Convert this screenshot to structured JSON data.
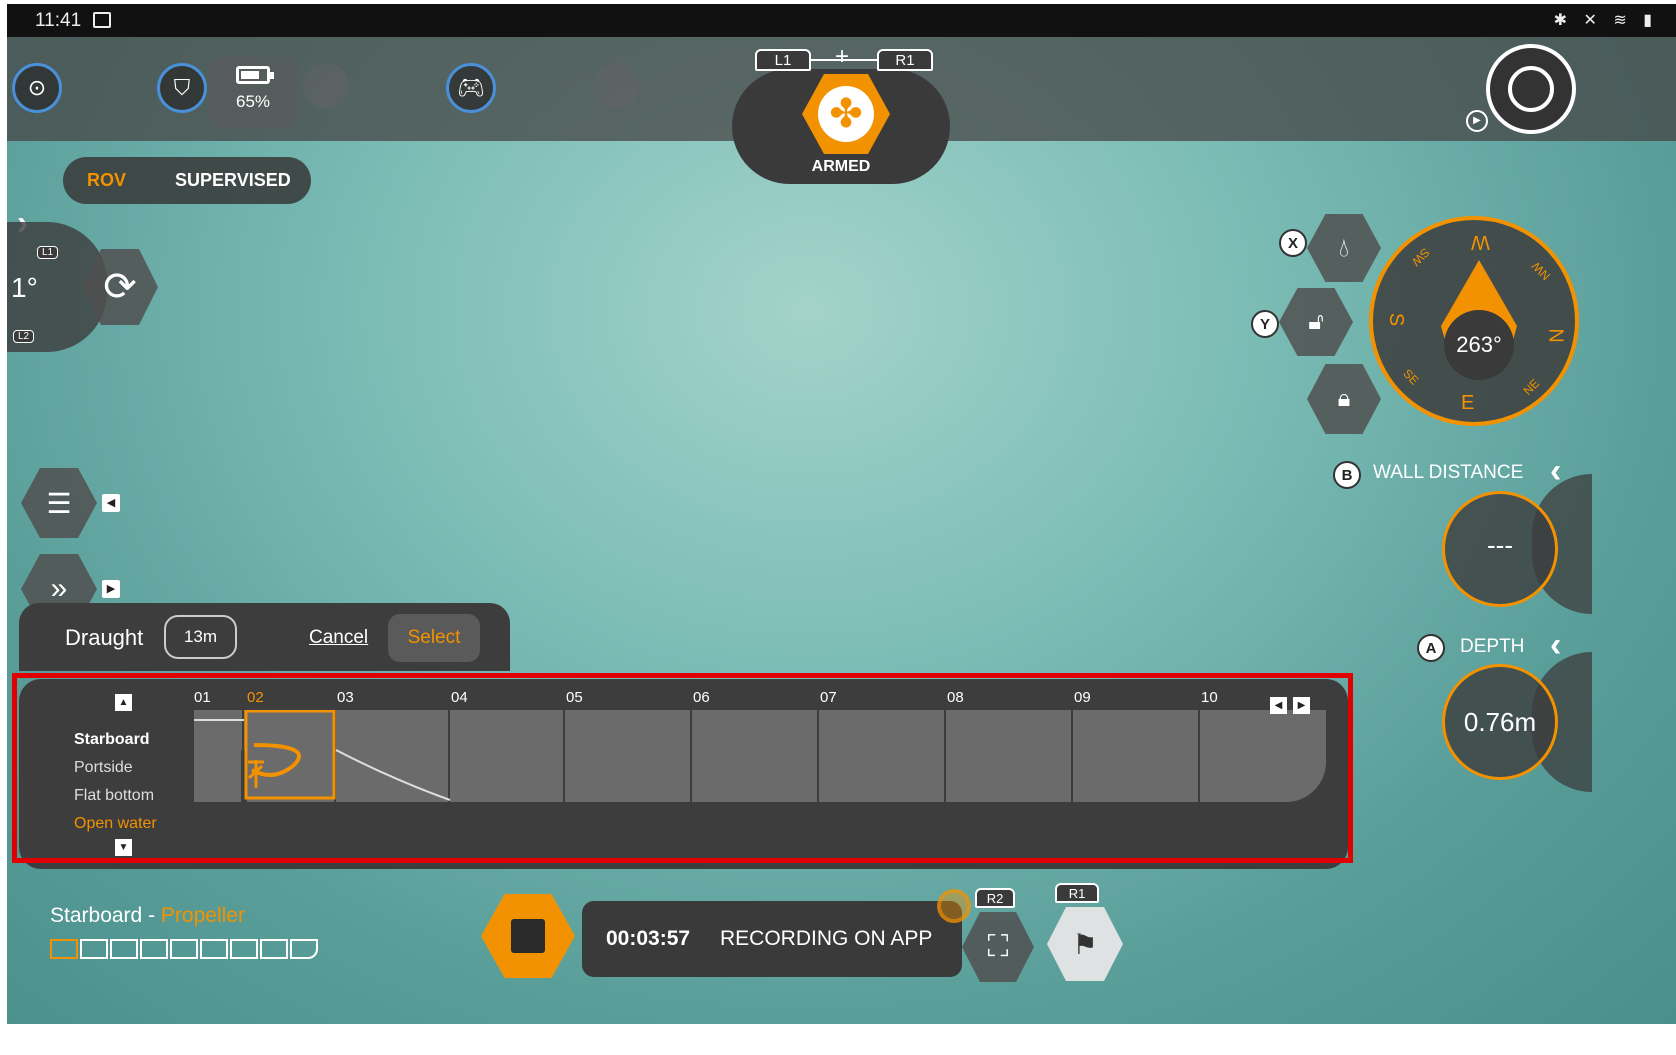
{
  "status_bar": {
    "time": "11:41",
    "icons": "✱ ✕ ≋ ▮"
  },
  "top_bar": {
    "battery_percent": "65%",
    "combo_left": "L1",
    "combo_plus": "+",
    "combo_right": "R1",
    "armed_label": "ARMED"
  },
  "mode_toggle": {
    "rov": "ROV",
    "supervised": "SUPERVISED"
  },
  "tilt": {
    "value": "1°",
    "tag_top": "L1",
    "tag_bottom": "L2"
  },
  "draught": {
    "label": "Draught",
    "value": "13m",
    "cancel": "Cancel",
    "select": "Select"
  },
  "hull": {
    "options": [
      "Starboard",
      "Portside",
      "Flat bottom",
      "Open water"
    ],
    "selected_option": "Starboard",
    "sections": [
      "01",
      "02",
      "03",
      "04",
      "05",
      "06",
      "07",
      "08",
      "09",
      "10"
    ],
    "selected_section": "02"
  },
  "bottom": {
    "location_side": "Starboard",
    "location_sep": " - ",
    "location_part": "Propeller",
    "timer": "00:03:57",
    "recording_text": "RECORDING ON APP",
    "tag_r2": "R2",
    "tag_r1": "R1"
  },
  "compass": {
    "heading": "263°",
    "labels": {
      "w": "W",
      "s": "S",
      "n": "N",
      "e": "E",
      "sw": "SW",
      "nw": "NW",
      "se": "SE",
      "ne": "NE"
    }
  },
  "buttons": {
    "x": "X",
    "y": "Y",
    "b": "B",
    "a": "A"
  },
  "wall_distance": {
    "label": "WALL DISTANCE",
    "value": "---"
  },
  "depth": {
    "label": "DEPTH",
    "value": "0.76m"
  },
  "colors": {
    "accent": "#f39200",
    "highlight_frame": "#e00000",
    "panel": "#3d3d3d"
  }
}
